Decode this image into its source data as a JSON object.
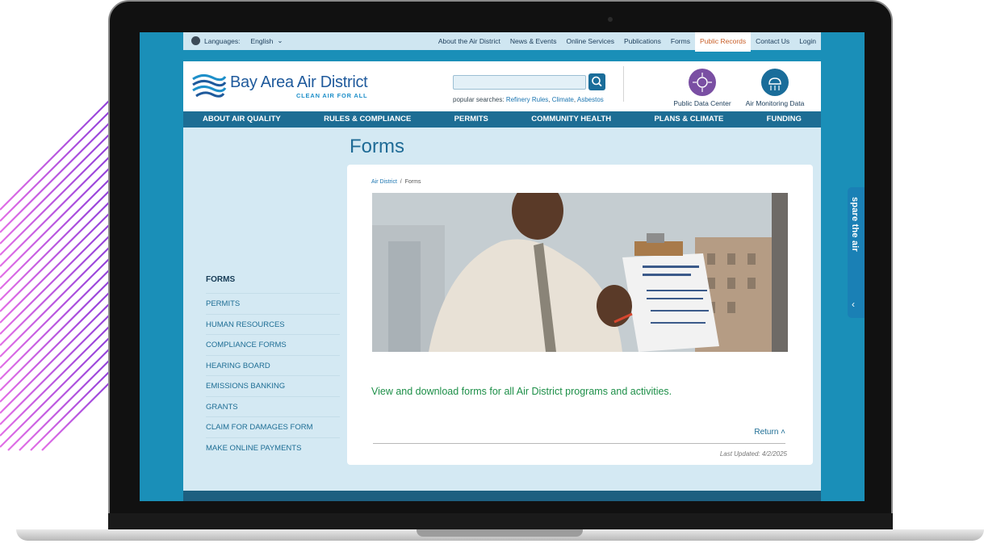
{
  "utility_bar": {
    "languages_label": "Languages:",
    "language_selected": "English",
    "links": [
      "About the Air District",
      "News & Events",
      "Online Services",
      "Publications",
      "Forms",
      "Public Records",
      "Contact Us",
      "Login"
    ],
    "active_link_index": 5
  },
  "header": {
    "logo_name": "Bay Area Air District",
    "logo_tagline": "CLEAN AIR FOR ALL",
    "search": {
      "placeholder": ""
    },
    "popular_label": "popular searches:",
    "popular_links": [
      "Refinery Rules",
      "Climate",
      "Asbestos"
    ],
    "quick_links": [
      {
        "label": "Public Data Center",
        "icon": "data-center-icon",
        "color": "#7a4fa3"
      },
      {
        "label": "Air Monitoring Data",
        "icon": "air-monitoring-icon",
        "color": "#1a6d9a"
      }
    ]
  },
  "main_nav": [
    "ABOUT AIR QUALITY",
    "RULES & COMPLIANCE",
    "PERMITS",
    "COMMUNITY HEALTH",
    "PLANS & CLIMATE",
    "FUNDING"
  ],
  "page": {
    "title": "Forms",
    "breadcrumb": {
      "home": "Air District",
      "separator": "/",
      "current": "Forms"
    },
    "intro": "View and download forms for all Air District programs and activities.",
    "return_label": "Return",
    "last_updated": "Last Updated: 4/2/2025"
  },
  "sidebar": {
    "items": [
      "FORMS",
      "PERMITS",
      "HUMAN RESOURCES",
      "COMPLIANCE FORMS",
      "HEARING BOARD",
      "EMISSIONS BANKING",
      "GRANTS",
      "CLAIM FOR DAMAGES FORM",
      "MAKE ONLINE PAYMENTS"
    ]
  },
  "spare_tab": {
    "label": "spare the air"
  },
  "colors": {
    "accent": "#1d6d94",
    "intro_text": "#1d8f48",
    "active_util_link": "#c9602a",
    "decor_stripes": "#a855d8"
  }
}
